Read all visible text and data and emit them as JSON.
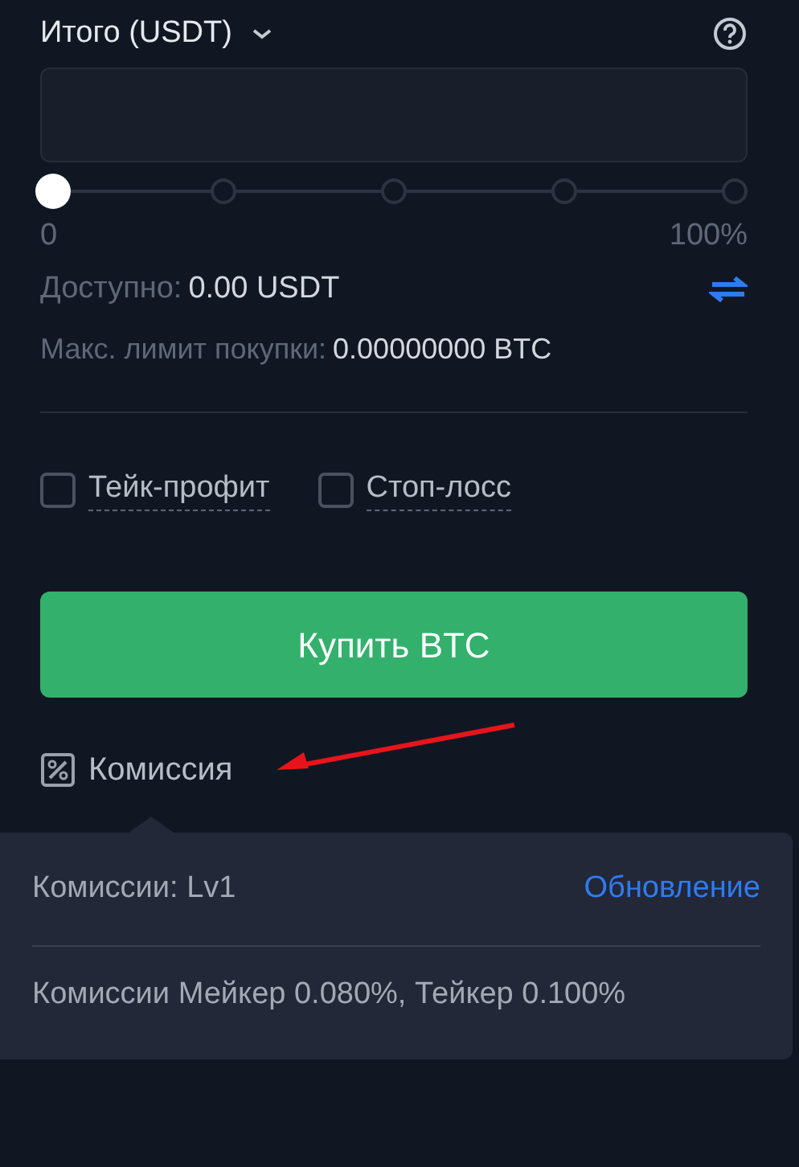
{
  "total": {
    "label": "Итого (USDT)",
    "expanded": false
  },
  "slider": {
    "level": 0,
    "min_label": "0",
    "max_label": "100%"
  },
  "available": {
    "label": "Доступно:",
    "value": "0.00 USDT"
  },
  "max_limit": {
    "label": "Макс. лимит покупки:",
    "value": "0.00000000 BTC"
  },
  "options": [
    {
      "label": "Тейк-профит",
      "checked": false
    },
    {
      "label": "Стоп-лосс",
      "checked": false
    }
  ],
  "buy_button": "Купить BTC",
  "fee": {
    "label": "Комиссия"
  },
  "popover": {
    "level_text": "Комиссии: Lv1",
    "link": "Обновление",
    "rates": "Комиссии Мейкер 0.080%, Тейкер 0.100%"
  }
}
